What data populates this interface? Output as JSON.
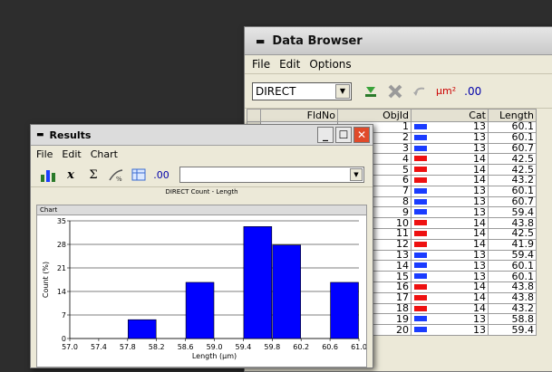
{
  "data_browser": {
    "title": "Data Browser",
    "menu": [
      "File",
      "Edit",
      "Options"
    ],
    "combo_value": "DIRECT",
    "unit_label": "µm²",
    "decimals_label": ".00",
    "columns": [
      "",
      "FldNo",
      "ObjId",
      "Cat",
      "Length"
    ],
    "rows": [
      {
        "objid": "1",
        "cat": "13",
        "length": "60.1",
        "color": "#1a3cff"
      },
      {
        "objid": "2",
        "cat": "13",
        "length": "60.1",
        "color": "#1a3cff"
      },
      {
        "objid": "3",
        "cat": "13",
        "length": "60.7",
        "color": "#1a3cff"
      },
      {
        "objid": "4",
        "cat": "14",
        "length": "42.5",
        "color": "#ee1111"
      },
      {
        "objid": "5",
        "cat": "14",
        "length": "42.5",
        "color": "#ee1111"
      },
      {
        "objid": "6",
        "cat": "14",
        "length": "43.2",
        "color": "#ee1111"
      },
      {
        "objid": "7",
        "cat": "13",
        "length": "60.1",
        "color": "#1a3cff"
      },
      {
        "objid": "8",
        "cat": "13",
        "length": "60.7",
        "color": "#1a3cff"
      },
      {
        "objid": "9",
        "cat": "13",
        "length": "59.4",
        "color": "#1a3cff"
      },
      {
        "objid": "10",
        "cat": "14",
        "length": "43.8",
        "color": "#ee1111"
      },
      {
        "objid": "11",
        "cat": "14",
        "length": "42.5",
        "color": "#ee1111"
      },
      {
        "objid": "12",
        "cat": "14",
        "length": "41.9",
        "color": "#ee1111"
      },
      {
        "objid": "13",
        "cat": "13",
        "length": "59.4",
        "color": "#1a3cff"
      },
      {
        "objid": "14",
        "cat": "13",
        "length": "60.1",
        "color": "#1a3cff"
      },
      {
        "objid": "15",
        "cat": "13",
        "length": "60.1",
        "color": "#1a3cff"
      },
      {
        "objid": "16",
        "cat": "14",
        "length": "43.8",
        "color": "#ee1111"
      },
      {
        "objid": "17",
        "cat": "14",
        "length": "43.8",
        "color": "#ee1111"
      },
      {
        "objid": "18",
        "cat": "14",
        "length": "43.2",
        "color": "#ee1111"
      },
      {
        "objid": "19",
        "cat": "13",
        "length": "58.8",
        "color": "#1a3cff"
      },
      {
        "objid": "20",
        "cat": "13",
        "length": "59.4",
        "color": "#1a3cff"
      }
    ]
  },
  "results": {
    "title": "Results",
    "menu": [
      "File",
      "Edit",
      "Chart"
    ],
    "decimals_label": ".00",
    "chart_header": "Chart"
  },
  "chart_data": {
    "type": "bar",
    "title": "DIRECT Count - Length",
    "xlabel": "Length (µm)",
    "ylabel": "Count (%)",
    "xlim": [
      57.0,
      61.0
    ],
    "ylim": [
      0,
      35
    ],
    "xticks": [
      "57.0",
      "57.4",
      "57.8",
      "58.2",
      "58.6",
      "59.0",
      "59.4",
      "59.8",
      "60.2",
      "60.6",
      "61.0"
    ],
    "yticks": [
      "0",
      "7",
      "14",
      "21",
      "28",
      "35"
    ],
    "bins": [
      {
        "from": 57.8,
        "to": 58.2,
        "value": 5.6
      },
      {
        "from": 58.6,
        "to": 59.0,
        "value": 16.7
      },
      {
        "from": 59.4,
        "to": 59.8,
        "value": 33.3
      },
      {
        "from": 59.8,
        "to": 60.2,
        "value": 27.8
      },
      {
        "from": 60.6,
        "to": 61.0,
        "value": 16.7
      }
    ],
    "bar_color": "#0000ff"
  }
}
